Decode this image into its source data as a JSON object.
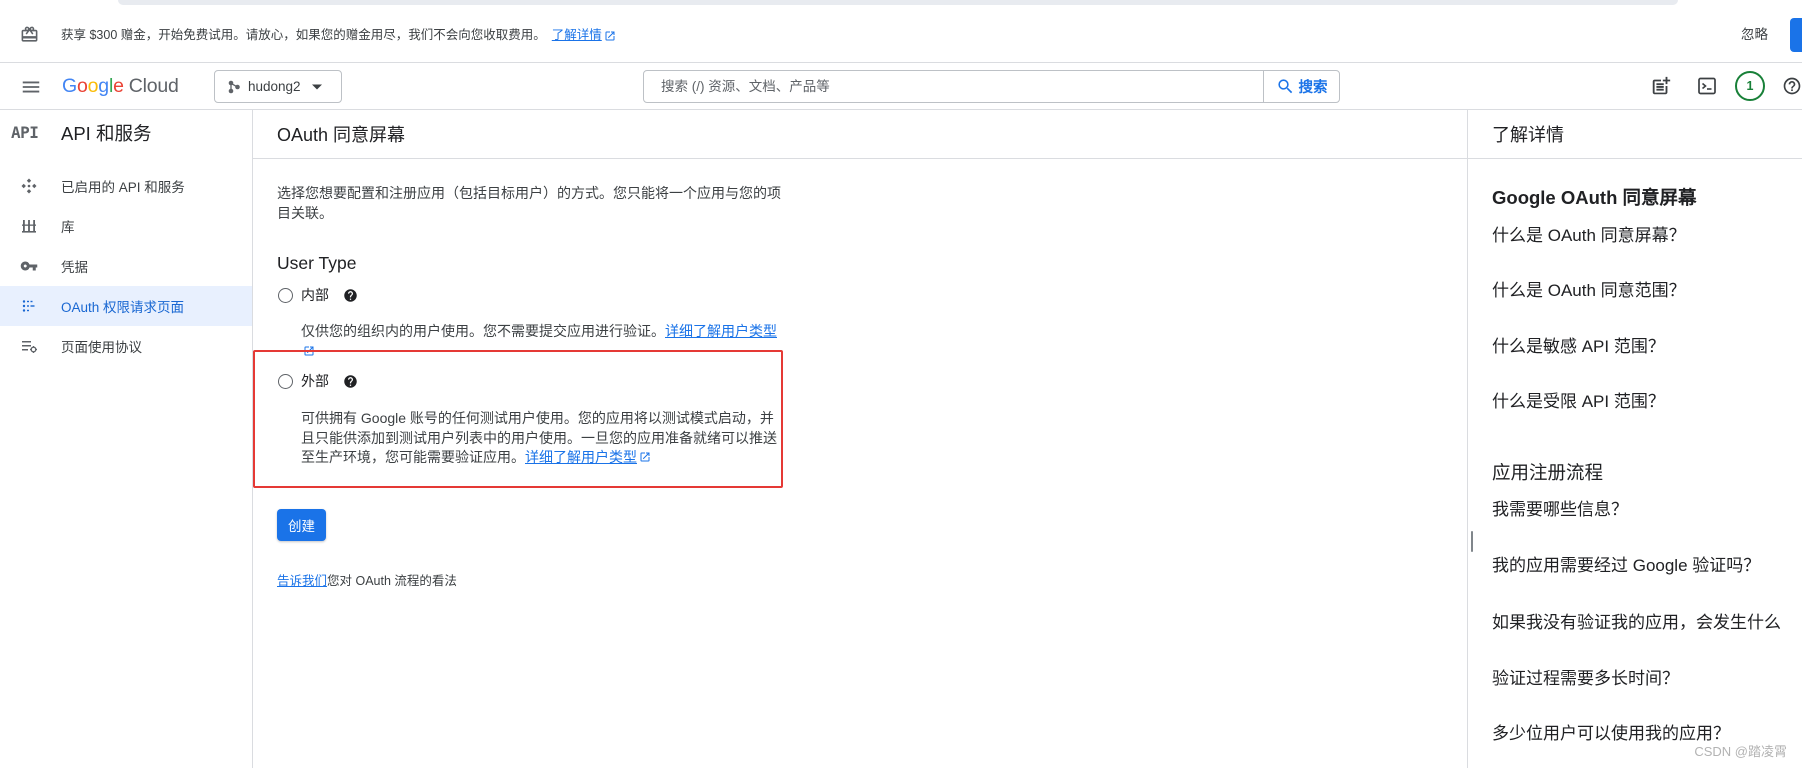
{
  "colors": {
    "accent": "#1a73e8",
    "selected_bg": "#e8f0fe",
    "selected_text": "#1967d2",
    "highlight_box": "#e53935",
    "badge_green": "#188038",
    "divider": "#dadce0",
    "text_primary": "#202124",
    "text_secondary": "#5f6368",
    "google_blue": "#4285F4",
    "google_red": "#EA4335",
    "google_yellow": "#FBBC05",
    "google_green": "#34A853"
  },
  "banner": {
    "icon": "gift-icon",
    "message": "获享 $300 赠金，开始免费试用。请放心，如果您的赠金用尽，我们不会向您收取费用。",
    "learn_more_label": "了解详情",
    "learn_more_icon": "external-link-icon",
    "dismiss_label": "忽略"
  },
  "header": {
    "menu_icon": "hamburger-menu-icon",
    "logo_letters": [
      "G",
      "o",
      "o",
      "g",
      "l",
      "e"
    ],
    "logo_product": "Cloud",
    "project": {
      "icon": "project-icon",
      "name": "hudong2",
      "dropdown_icon": "arrow-drop-down-icon"
    },
    "search": {
      "placeholder": "搜索 (/) 资源、文档、产品等",
      "value": "",
      "button_label": "搜索",
      "icon": "search-icon"
    },
    "actions": [
      {
        "icon": "release-notes-icon"
      },
      {
        "icon": "terminal-icon"
      },
      {
        "icon": "notification-badge",
        "count": "1"
      },
      {
        "icon": "help-icon"
      }
    ]
  },
  "sidebar": {
    "icon_text": "API",
    "title": "API 和服务",
    "items": [
      {
        "label": "已启用的 API 和服务",
        "icon": "enabled-apis-icon",
        "selected": false
      },
      {
        "label": "库",
        "icon": "library-icon",
        "selected": false
      },
      {
        "label": "凭据",
        "icon": "key-icon",
        "selected": false
      },
      {
        "label": "OAuth 权限请求页面",
        "icon": "consent-screen-icon",
        "selected": true
      },
      {
        "label": "页面使用协议",
        "icon": "agreements-settings-icon",
        "selected": false
      }
    ]
  },
  "main": {
    "title": "OAuth 同意屏幕",
    "description": "选择您想要配置和注册应用（包括目标用户）的方式。您只能将一个应用与您的项目关联。",
    "user_type": {
      "label": "User Type",
      "options": [
        {
          "label": "内部",
          "checked": false,
          "highlighted": false,
          "help_icon": "help-icon",
          "description": "仅供您的组织内的用户使用。您不需要提交应用进行验证。",
          "link_label": "详细了解用户类型",
          "link_icon": "external-link-icon"
        },
        {
          "label": "外部",
          "checked": false,
          "highlighted": true,
          "help_icon": "help-icon",
          "description": "可供拥有 Google 账号的任何测试用户使用。您的应用将以测试模式启动，并且只能供添加到测试用户列表中的用户使用。一旦您的应用准备就绪可以推送至生产环境，您可能需要验证应用。",
          "link_label": "详细了解用户类型",
          "link_icon": "external-link-icon"
        }
      ]
    },
    "create_label": "创建",
    "feedback": {
      "link_label": "告诉我们",
      "text": "您对 OAuth 流程的看法"
    }
  },
  "learn_more_panel": {
    "title": "了解详情",
    "sections": [
      {
        "heading": "Google OAuth 同意屏幕",
        "links": [
          "什么是 OAuth 同意屏幕？",
          "什么是 OAuth 同意范围？",
          "什么是敏感 API 范围？",
          "什么是受限 API 范围？"
        ]
      },
      {
        "heading": "应用注册流程",
        "links": [
          "我需要哪些信息？",
          "我的应用需要经过 Google 验证吗？",
          "如果我没有验证我的应用，会发生什么",
          "验证过程需要多长时间？",
          "多少位用户可以使用我的应用？"
        ]
      }
    ]
  },
  "watermark": "CSDN @踏凌霄"
}
